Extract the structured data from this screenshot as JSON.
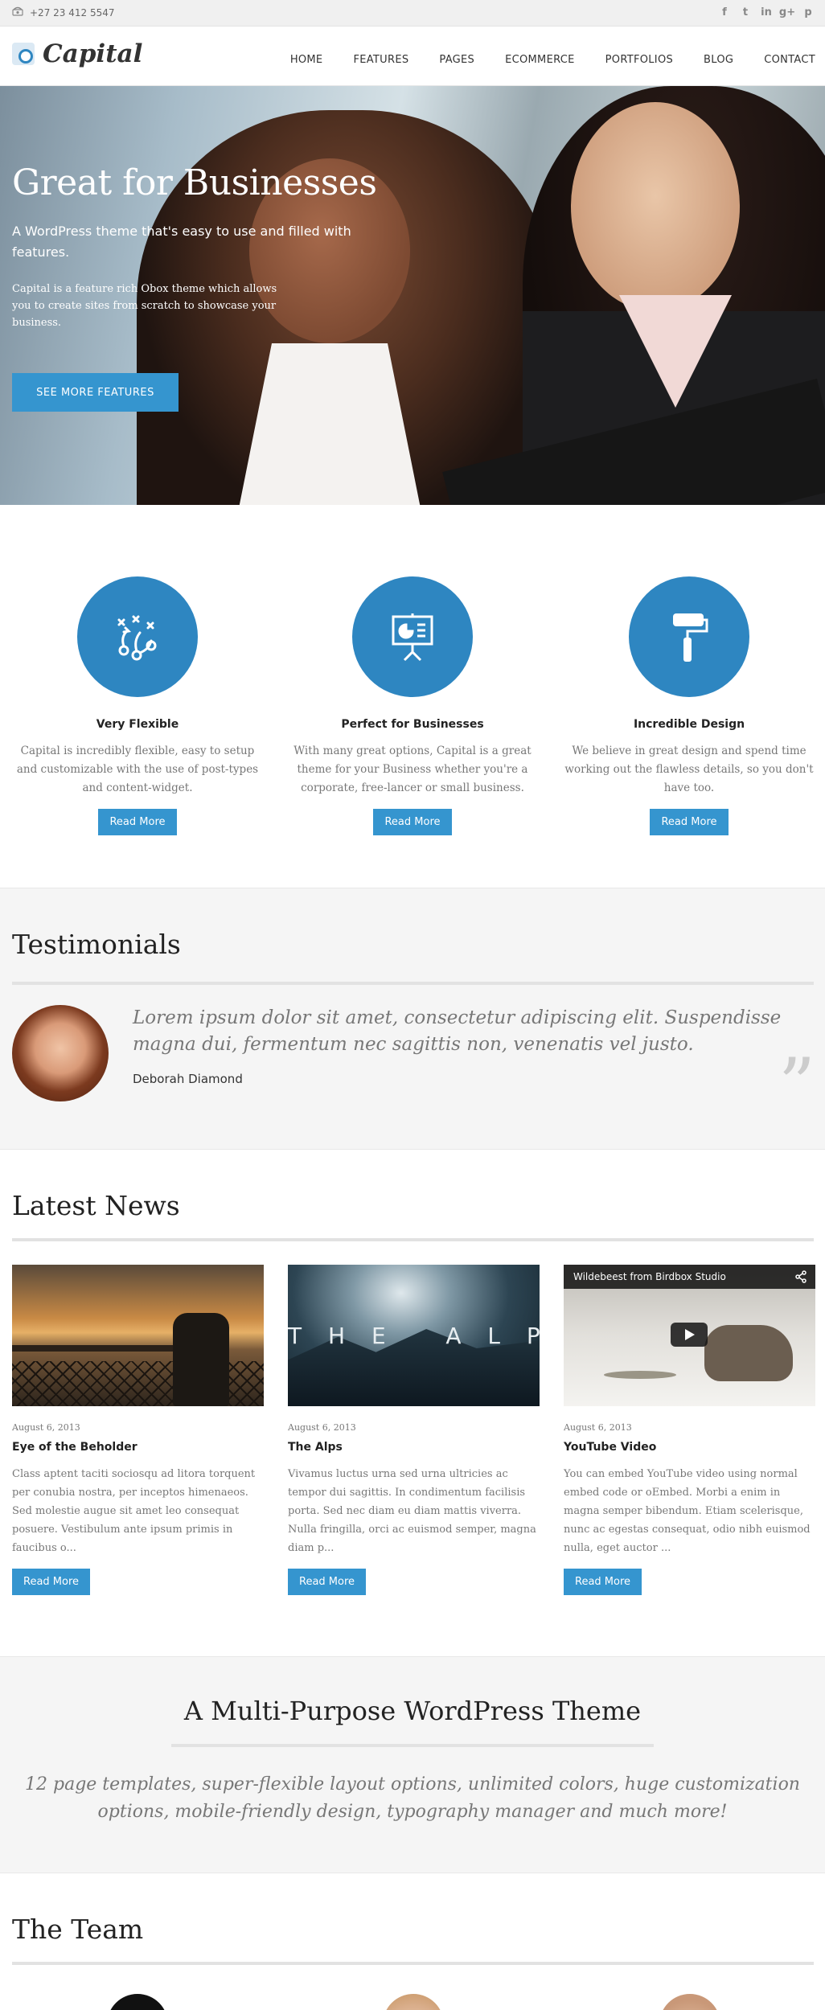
{
  "topbar": {
    "phone": "+27 23 412 5547",
    "social": [
      {
        "icon": "facebook-icon",
        "glyph": "f"
      },
      {
        "icon": "twitter-icon",
        "glyph": "t"
      },
      {
        "icon": "linkedin-icon",
        "glyph": "in"
      },
      {
        "icon": "google-plus-icon",
        "glyph": "g+"
      },
      {
        "icon": "pinterest-icon",
        "glyph": "p"
      }
    ]
  },
  "header": {
    "logo_text": "Capital",
    "nav": [
      "HOME",
      "FEATURES",
      "PAGES",
      "ECOMMERCE",
      "PORTFOLIOS",
      "BLOG",
      "CONTACT"
    ]
  },
  "hero": {
    "title": "Great for Businesses",
    "subtitle": "A WordPress theme that's easy to use and filled with features.",
    "description": "Capital is a feature rich Obox theme which allows you to create sites from scratch to showcase your business.",
    "cta": "SEE MORE FEATURES"
  },
  "features": [
    {
      "icon": "strategy-play-icon",
      "title": "Very Flexible",
      "text": "Capital is incredibly flexible, easy to setup and customizable with the use of post-types and content-widget.",
      "button": "Read More"
    },
    {
      "icon": "presentation-board-icon",
      "title": "Perfect for Businesses",
      "text": "With many great options, Capital is a great theme for your Business whether you're a corporate, free-lancer or small business.",
      "button": "Read More"
    },
    {
      "icon": "paint-roller-icon",
      "title": "Incredible Design",
      "text": "We believe in great design and spend time working out the flawless details, so you don't have too.",
      "button": "Read More"
    }
  ],
  "testimonials": {
    "title": "Testimonials",
    "quote": "Lorem ipsum dolor sit amet, consectetur adipiscing elit. Suspendisse magna dui, fermentum nec sagittis non, venenatis vel justo.",
    "author": "Deborah Diamond"
  },
  "news": {
    "title": "Latest News",
    "posts": [
      {
        "date": "August 6, 2013",
        "title": "Eye of the Beholder",
        "excerpt": "Class aptent taciti sociosqu ad litora torquent per conubia nostra, per inceptos himenaeos. Sed molestie augue sit amet leo consequat posuere. Vestibulum ante ipsum primis in faucibus o...",
        "button": "Read More"
      },
      {
        "date": "August 6, 2013",
        "title": "The Alps",
        "image_text": "T H E   A L P S",
        "excerpt": "Vivamus luctus urna sed urna ultricies ac tempor dui sagittis. In condimentum facilisis porta. Sed nec diam eu diam mattis viverra. Nulla fringilla, orci ac euismod semper, magna diam p...",
        "button": "Read More"
      },
      {
        "date": "August 6, 2013",
        "title": "YouTube Video",
        "video_title": "Wildebeest from Birdbox Studio",
        "excerpt": "You can embed YouTube video using normal embed code or oEmbed. Morbi a enim in magna semper bibendum. Etiam scelerisque, nunc ac egestas consequat, odio nibh euismod nulla, eget auctor ...",
        "button": "Read More"
      }
    ]
  },
  "multi": {
    "title": "A Multi-Purpose WordPress Theme",
    "text": "12 page templates, super-flexible layout options, unlimited colors, huge customization options, mobile-friendly design, typography manager and much more!"
  },
  "team": {
    "title": "The Team"
  },
  "colors": {
    "accent": "#3595cf",
    "circle": "#2e86c1"
  }
}
